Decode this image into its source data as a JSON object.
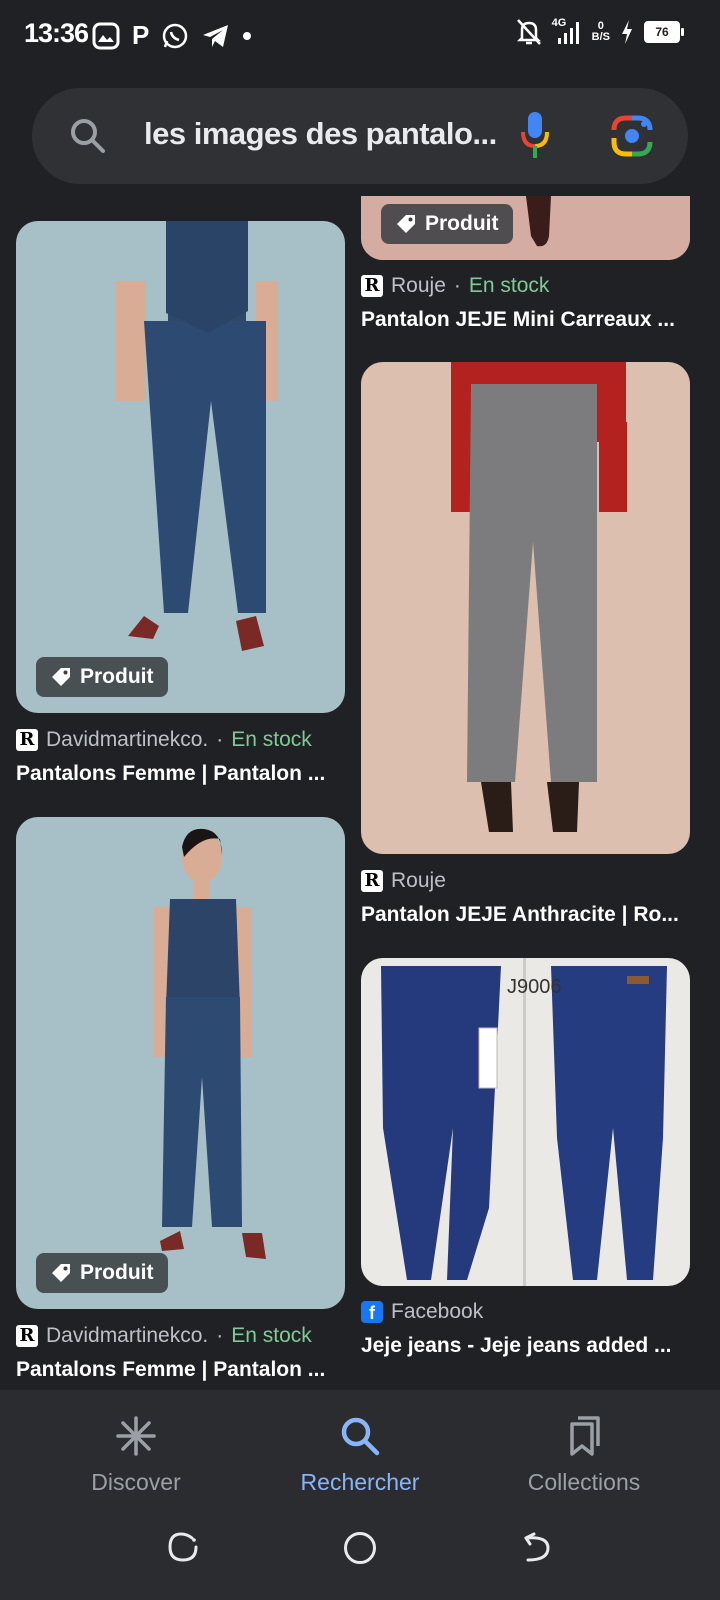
{
  "status_bar": {
    "time": "13:36",
    "network_type": "4G",
    "data_speed_value": "0",
    "data_speed_unit": "B/S",
    "battery": "76",
    "icons": [
      "gallery-icon",
      "p-icon",
      "whatsapp-icon",
      "telegram-icon",
      "dot-icon",
      "mute-icon",
      "signal-icon",
      "charging-icon",
      "battery-icon"
    ]
  },
  "search": {
    "query": "les images des pantalo..."
  },
  "results": [
    {
      "badge": "Produit",
      "source": "Davidmartinekco.",
      "separator": " · ",
      "stock": "En stock",
      "title": "Pantalons Femme | Pantalon ..."
    },
    {
      "badge": "Produit",
      "source": "Rouje",
      "separator": " · ",
      "stock": "En stock",
      "title": "Pantalon JEJE Mini Carreaux ..."
    },
    {
      "source": "Rouje",
      "title": "Pantalon JEJE Anthracite | Ro..."
    },
    {
      "badge": "Produit",
      "source": "Davidmartinekco.",
      "separator": " · ",
      "stock": "En stock",
      "title": "Pantalons Femme | Pantalon ..."
    },
    {
      "source": "Facebook",
      "title": "Jeje jeans - Jeje jeans added ...",
      "image_label": "J9006"
    }
  ],
  "bottom_nav": {
    "items": [
      {
        "label": "Discover",
        "icon": "asterisk-icon"
      },
      {
        "label": "Rechercher",
        "icon": "search-icon",
        "active": true
      },
      {
        "label": "Collections",
        "icon": "bookmarks-icon"
      }
    ]
  },
  "colors": {
    "background": "#1f2125",
    "search_bar": "#303134",
    "active": "#8ab4f8",
    "in_stock": "#81c995"
  }
}
